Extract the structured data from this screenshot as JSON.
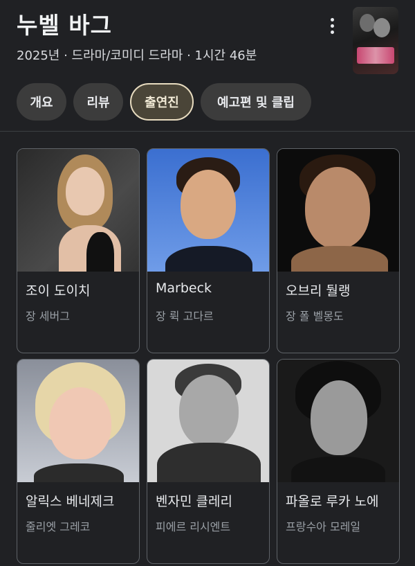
{
  "header": {
    "title": "누벨 바그",
    "meta": "2025년 · 드라마/코미디 드라마 · 1시간 46분"
  },
  "tabs": [
    {
      "label": "개요",
      "active": false
    },
    {
      "label": "리뷰",
      "active": false
    },
    {
      "label": "출연진",
      "active": true
    },
    {
      "label": "예고편 및 클립",
      "active": false
    }
  ],
  "cast": [
    {
      "name": "조이 도이치",
      "role": "장 세버그"
    },
    {
      "name": "Marbeck",
      "role": "장 뤽 고다르"
    },
    {
      "name": "오브리 둴랭",
      "role": "장 폴 벨몽도"
    },
    {
      "name": "알릭스 베네제크",
      "role": "줄리엣 그레코"
    },
    {
      "name": "벤자민 클레리",
      "role": "피에르 리시엔트"
    },
    {
      "name": "파올로 루카 노에",
      "role": "프랑수아 모레일"
    }
  ],
  "icons": {
    "more": "more-vert-icon"
  },
  "colors": {
    "background": "#202124",
    "active_tab_border": "#e8dcc0",
    "card_border": "#5f6368"
  }
}
